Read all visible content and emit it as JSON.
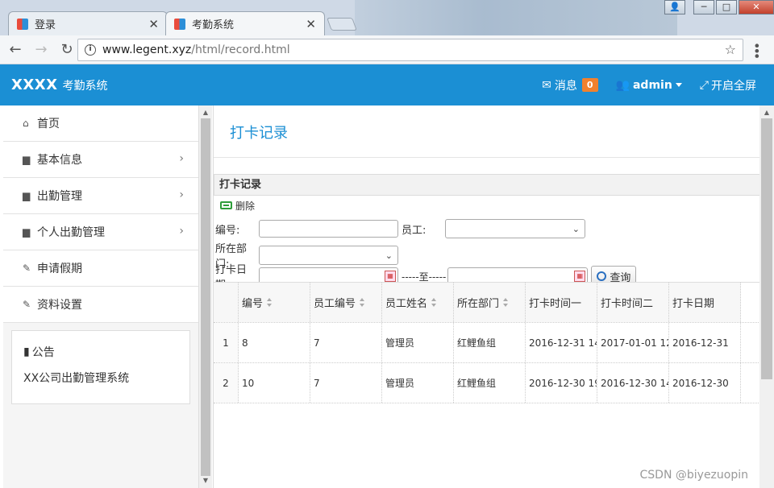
{
  "browser": {
    "tabs": [
      {
        "title": "登录"
      },
      {
        "title": "考勤系统"
      }
    ],
    "url_host": "www.legent.xyz",
    "url_path": "/html/record.html"
  },
  "header": {
    "brand": "XXXX",
    "brand_sub": "考勤系统",
    "messages_label": "消息",
    "messages_count": "0",
    "user": "admin",
    "fullscreen_label": "开启全屏",
    "bg_color": "#1b8fd4",
    "badge_color": "#f0812e"
  },
  "sidebar": {
    "items": [
      {
        "label": "首页",
        "icon": "home-icon"
      },
      {
        "label": "基本信息",
        "icon": "file-icon"
      },
      {
        "label": "出勤管理",
        "icon": "file-icon"
      },
      {
        "label": "个人出勤管理",
        "icon": "file-icon"
      },
      {
        "label": "申请假期",
        "icon": "edit-icon"
      },
      {
        "label": "资料设置",
        "icon": "edit-icon"
      }
    ],
    "notice_title": "公告",
    "notice_text": "XX公司出勤管理系统"
  },
  "main": {
    "page_title": "打卡记录",
    "panel_title": "打卡记录",
    "delete_label": "删除",
    "filters": {
      "id_label": "编号:",
      "employee_label": "员工:",
      "dept_label": "所在部门:",
      "date_label": "打卡日期:",
      "to_label": "-----至-----",
      "search_label": "查询"
    },
    "table": {
      "columns": [
        "编号",
        "员工编号",
        "员工姓名",
        "所在部门",
        "打卡时间一",
        "打卡时间二",
        "打卡日期"
      ],
      "rows": [
        {
          "n": "1",
          "cells": [
            "8",
            "7",
            "管理员",
            "红鲤鱼组",
            "2016-12-31 14:",
            "2017-01-01 12:",
            "2016-12-31"
          ]
        },
        {
          "n": "2",
          "cells": [
            "10",
            "7",
            "管理员",
            "红鲤鱼组",
            "2016-12-30 19:",
            "2016-12-30 14:",
            "2016-12-30"
          ]
        }
      ]
    }
  },
  "watermark": "CSDN @biyezuopin"
}
